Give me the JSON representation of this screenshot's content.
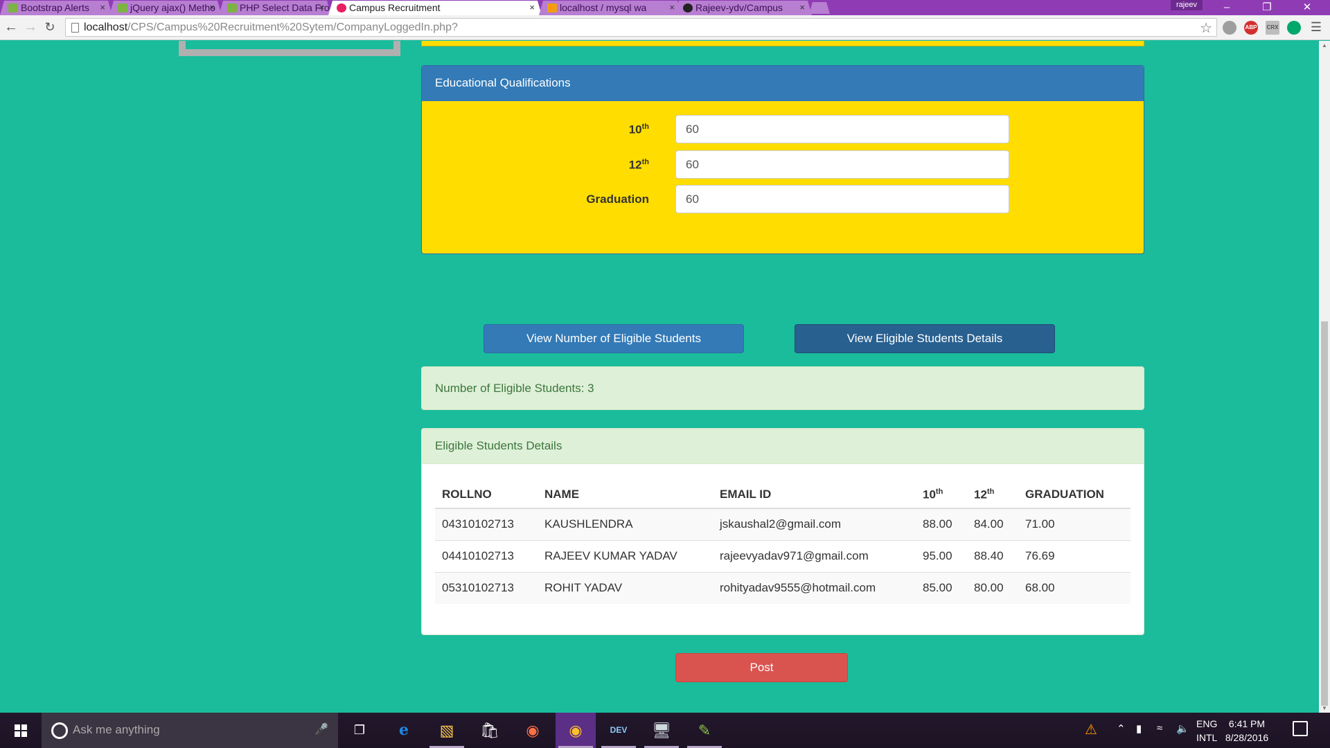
{
  "browser": {
    "tabs": [
      {
        "title": "Bootstrap Alerts",
        "icon": "w3-icon",
        "active": false
      },
      {
        "title": "jQuery ajax() Metho",
        "icon": "w3-icon",
        "active": false
      },
      {
        "title": "PHP Select Data Fro",
        "icon": "w3-icon",
        "active": false
      },
      {
        "title": "Campus Recruitment",
        "icon": "campus-icon",
        "active": true
      },
      {
        "title": "localhost / mysql wa",
        "icon": "phpmyadmin-icon",
        "active": false
      },
      {
        "title": "Rajeev-ydv/Campus",
        "icon": "github-icon",
        "active": false
      }
    ],
    "tab_close": "×",
    "profile": "rajeev",
    "url_host": "localhost",
    "url_path": "/CPS/Campus%20Recruitment%20Sytem/CompanyLoggedIn.php?",
    "extensions": [
      "ABP",
      "CRX"
    ]
  },
  "edu": {
    "title": "Educational Qualifications",
    "fields": [
      {
        "label": "10",
        "sup": "th",
        "value": "60"
      },
      {
        "label": "12",
        "sup": "th",
        "value": "60"
      },
      {
        "label": "Graduation",
        "sup": "",
        "value": "60"
      }
    ]
  },
  "buttons": {
    "view_count": "View Number of Eligible Students",
    "view_details": "View Eligible Students Details",
    "post": "Post"
  },
  "eligible_count_text": "Number of Eligible Students: 3",
  "details": {
    "title": "Eligible Students Details",
    "headers": {
      "rollno": "ROLLNO",
      "name": "NAME",
      "email": "EMAIL ID",
      "tenth": "10",
      "tenth_sup": "th",
      "twelfth": "12",
      "twelfth_sup": "th",
      "graduation": "GRADUATION"
    },
    "rows": [
      {
        "rollno": "04310102713",
        "name": "KAUSHLENDRA",
        "email": "jskaushal2@gmail.com",
        "tenth": "88.00",
        "twelfth": "84.00",
        "graduation": "71.00"
      },
      {
        "rollno": "04410102713",
        "name": "RAJEEV KUMAR YADAV",
        "email": "rajeevyadav971@gmail.com",
        "tenth": "95.00",
        "twelfth": "88.40",
        "graduation": "76.69"
      },
      {
        "rollno": "05310102713",
        "name": "ROHIT YADAV",
        "email": "rohityadav9555@hotmail.com",
        "tenth": "85.00",
        "twelfth": "80.00",
        "graduation": "68.00"
      }
    ]
  },
  "taskbar": {
    "search_placeholder": "Ask me anything",
    "lang_top": "ENG",
    "lang_bottom": "INTL",
    "time": "6:41 PM",
    "date": "8/28/2016"
  },
  "colors": {
    "page_bg": "#1abc9c",
    "panel_yellow": "#ffdd00",
    "primary": "#337ab7",
    "success_bg": "#dff0d8",
    "danger": "#d9534f"
  }
}
